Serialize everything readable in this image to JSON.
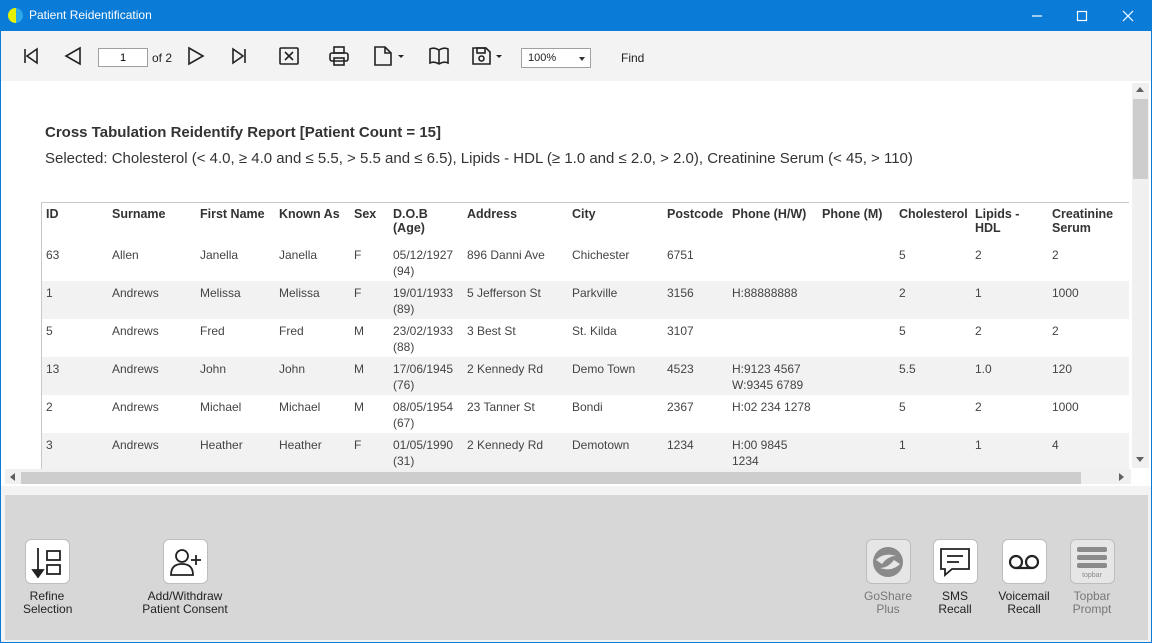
{
  "window": {
    "title": "Patient Reidentification"
  },
  "toolbar": {
    "page_current": "1",
    "page_of": "of 2",
    "zoom": "100%",
    "find_label": "Find"
  },
  "report": {
    "title": "Cross Tabulation Reidentify Report  [Patient Count = 15]",
    "subtitle": "Selected: Cholesterol (< 4.0, ≥ 4.0 and ≤ 5.5, > 5.5 and ≤ 6.5), Lipids - HDL (≥ 1.0 and ≤ 2.0, > 2.0), Creatinine Serum (< 45, > 110)"
  },
  "table": {
    "headers": [
      [
        "ID",
        ""
      ],
      [
        "Surname",
        ""
      ],
      [
        "First Name",
        ""
      ],
      [
        "Known As",
        ""
      ],
      [
        "Sex",
        ""
      ],
      [
        "D.O.B",
        "(Age)"
      ],
      [
        "Address",
        ""
      ],
      [
        "City",
        ""
      ],
      [
        "Postcode",
        ""
      ],
      [
        "Phone (H/W)",
        ""
      ],
      [
        "Phone (M)",
        ""
      ],
      [
        "Cholesterol",
        ""
      ],
      [
        "Lipids -",
        "HDL"
      ],
      [
        "Creatinine",
        "Serum"
      ]
    ],
    "rows": [
      {
        "id": "63",
        "surname": "Allen",
        "first": "Janella",
        "known": "Janella",
        "sex": "F",
        "dob": "05/12/1927",
        "age": "(94)",
        "address": "896 Danni Ave",
        "city": "Chichester",
        "postcode": "6751",
        "phone_hw": "",
        "phone_hw2": "",
        "phone_m": "",
        "chol": "5",
        "hdl": "2",
        "creat": "2"
      },
      {
        "id": "1",
        "surname": "Andrews",
        "first": "Melissa",
        "known": "Melissa",
        "sex": "F",
        "dob": "19/01/1933",
        "age": "(89)",
        "address": "5 Jefferson St",
        "city": "Parkville",
        "postcode": "3156",
        "phone_hw": "H:88888888",
        "phone_hw2": "",
        "phone_m": "",
        "chol": "2",
        "hdl": "1",
        "creat": "1000"
      },
      {
        "id": "5",
        "surname": "Andrews",
        "first": "Fred",
        "known": "Fred",
        "sex": "M",
        "dob": "23/02/1933",
        "age": "(88)",
        "address": "3 Best St",
        "city": "St. Kilda",
        "postcode": "3107",
        "phone_hw": "",
        "phone_hw2": "",
        "phone_m": "",
        "chol": "5",
        "hdl": "2",
        "creat": "2"
      },
      {
        "id": "13",
        "surname": "Andrews",
        "first": "John",
        "known": "John",
        "sex": "M",
        "dob": "17/06/1945",
        "age": "(76)",
        "address": "2 Kennedy Rd",
        "city": "Demo Town",
        "postcode": "4523",
        "phone_hw": "H:9123 4567",
        "phone_hw2": "W:9345 6789",
        "phone_m": "",
        "chol": "5.5",
        "hdl": "1.0",
        "creat": "120"
      },
      {
        "id": "2",
        "surname": "Andrews",
        "first": "Michael",
        "known": "Michael",
        "sex": "M",
        "dob": "08/05/1954",
        "age": "(67)",
        "address": "23 Tanner St",
        "city": "Bondi",
        "postcode": "2367",
        "phone_hw": "H:02 234 1278",
        "phone_hw2": "",
        "phone_m": "",
        "chol": "5",
        "hdl": "2",
        "creat": "1000"
      },
      {
        "id": "3",
        "surname": "Andrews",
        "first": "Heather",
        "known": "Heather",
        "sex": "F",
        "dob": "01/05/1990",
        "age": "(31)",
        "address": "2 Kennedy Rd",
        "city": "Demotown",
        "postcode": "1234",
        "phone_hw": "H:00 9845 1234",
        "phone_hw2": "",
        "phone_m": "",
        "chol": "1",
        "hdl": "1",
        "creat": "4"
      }
    ]
  },
  "actions": {
    "refine": [
      "Refine",
      "Selection"
    ],
    "consent": [
      "Add/Withdraw",
      "Patient Consent"
    ],
    "goshare": [
      "GoShare",
      "Plus"
    ],
    "sms": [
      "SMS",
      "Recall"
    ],
    "voicemail": [
      "Voicemail",
      "Recall"
    ],
    "topbar": [
      "Topbar",
      "Prompt"
    ],
    "topbar_logo": "topbar"
  }
}
